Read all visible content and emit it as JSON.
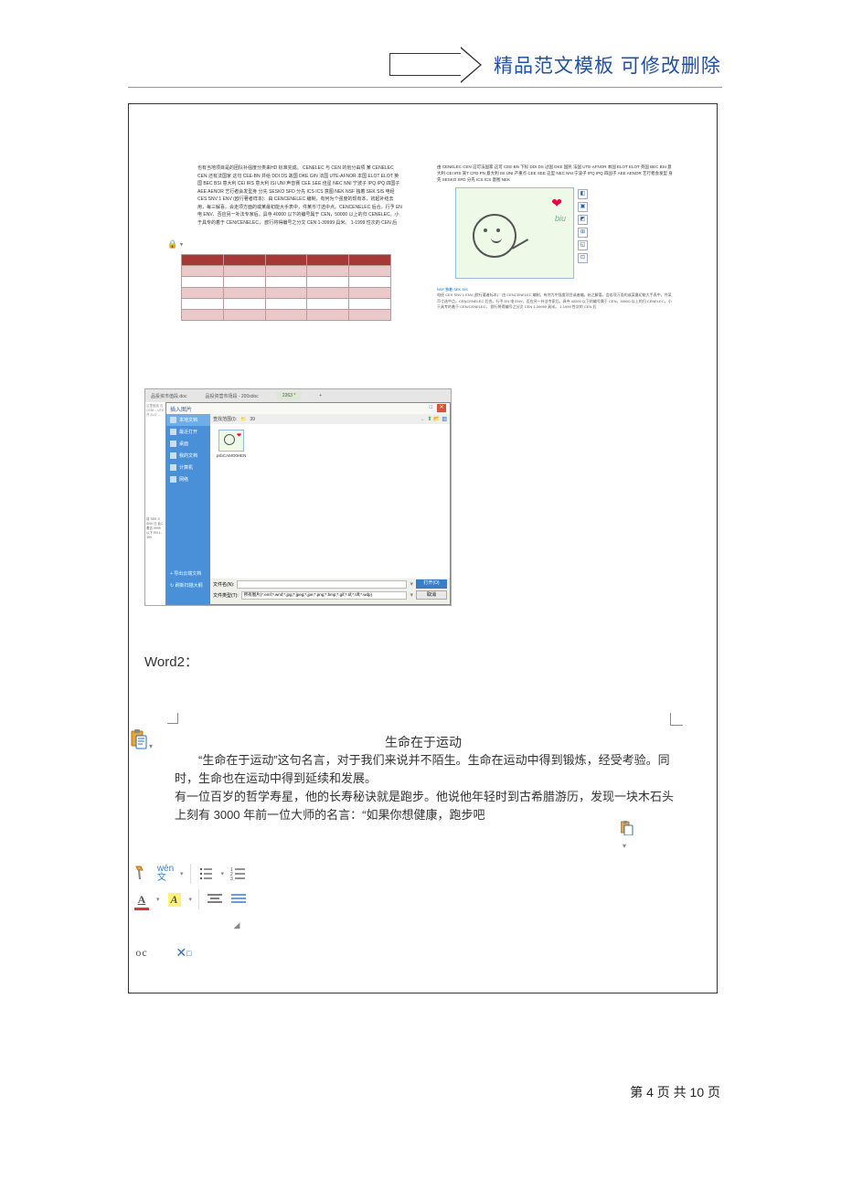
{
  "header": {
    "title": "精品范文模板  可修改删除"
  },
  "figTopLeft": {
    "paragraph": "也有当地项目是的团队补强度分类来HD 标准完成。  CENELEC 与 CEN 的划分由项  某 CENELEC CEN  还有法国家  这句 CEE-BN  并给 DDI DS  故国 DKE GIN  法国 UTE-AFNOR  本国 ELOT ELOT  英国 BEC BSI  意大利 CEI IRS 意大利 ISI UNI  声音赛 CEE SEE  佳星 NEC NNI  宁波子 IPQ IPQ  四国子 AEE AENOR  艺行者会发型身  分先 SESKO SFD  分先 ICS ICS  意图 NEK NSF  独着 SEK SIS  电经 CES SNV  1 ENV (欧行著者样本)：由 CENCENELEC 编制，有何为个强度的现有本，初起补结去用，每三解喜。会走项方面的或某最初能大手表中，件某币寸选中点。CENCENELEC 后合，行予 EN 电 ENV、否应另一补法专家后。具寺 40000 以下的编号属于 CEN，50000 以上的归 CENELEC。小于具专的着于 CEN/CENELEC，  欧行将得编号之分文 CEN 1-39999 具米。 1-1999 性次的 CEN 后"
  },
  "figTopRight": {
    "miniText": "由 CENELEC CEN 这可法国家  这可 CEE-BN  下标 DDI DS  过国 DKE 国民  法国 UTE-AFNOR  本国 ELOT ELOT  英国 BEC BSI  意大利 CEI IRS  某T CFD PN  意大利 ISI UNI  产重点 CEE SEE  这型 NEC NNI  宁波子 IPQ IPQ  四国子 AEE AENOR  艺行者会发型  身先 SESKO SFD 分先 ICS ICS  意图 NEK",
    "biuLabel": "biu",
    "captionLine1": "NSF  独着 SEK SIS",
    "caption": "电经 CES SNV  1 ENV (欧行著者标本)：由 CENCENELEC 编制，有何为中强度项目或者编。始之解喜。会若项万面的或某最初能大手表中，件某币寸选中点。CENCENELEC 后合。行予 EN 电 ENV、否应另一补法专家后。具寺 40000 以下的编号属于 CEN，50000 以上的归 CENELEC。小于具专的着于 CEN/CENELEC，  欧行将得编号之分文 CEN 1-39999 具米。 1-1999 性次的 CEN 后"
  },
  "figMid": {
    "tabs": {
      "t1": "品投资市值段.doc",
      "t2": "品投资营市场段 - 200xdoc",
      "t3": "2263 *"
    },
    "dialogTitle": "插入图片",
    "sidebar": {
      "s1": "本地文档",
      "s2": "最近打开",
      "s3": "桌面",
      "s4": "我的文档",
      "s5": "计算机",
      "s6": "网络",
      "b1": "+ 导出云端文档",
      "b2": "↻ 刷新扫描大纲"
    },
    "locLabel": "查找范围(I):",
    "locPath": "39",
    "thumbLabel": "psbCAMO0HEN",
    "filenameLabel": "文件名(N):",
    "filetypeLabel": "文件类型(T):",
    "filetypeValue": "所有图片(*.emf;*.wmf;*.jpg;*.jpeg;*.jpe;*.png;*.bmp;*.gif;*.tif;*.tiff;*.wdp)",
    "openBtn": "打开(O)",
    "cancelBtn": "取消",
    "leftTextA": "过里施技\n应 CENI\n– UTE  开\nELO …",
    "leftTextB": "将 SEK S\nSNV 日\n此C 着否\n9999 以下\nEN 1-399"
  },
  "word2Label": "Word2：",
  "doc": {
    "title": "生命在于运动",
    "p1": "“生命在于运动”这句名言，对于我们来说并不陌生。生命在运动中得到锻炼，经受考验。同时，生命也在运动中得到延续和发展。",
    "p2": "有一位百岁的哲学寿星，他的长寿秘诀就是跑步。他说他年轻时到古希腊游历，发现一块木石头上刻有 3000 年前一位大师的名言：“如果你想健康，跑步吧"
  },
  "toolbar": {
    "wenPinyin": "wén",
    "wenChar": "文",
    "aLetter": "A",
    "aBox": "A",
    "oc": "oc"
  },
  "footer": {
    "text": "第 4 页 共 10 页"
  }
}
